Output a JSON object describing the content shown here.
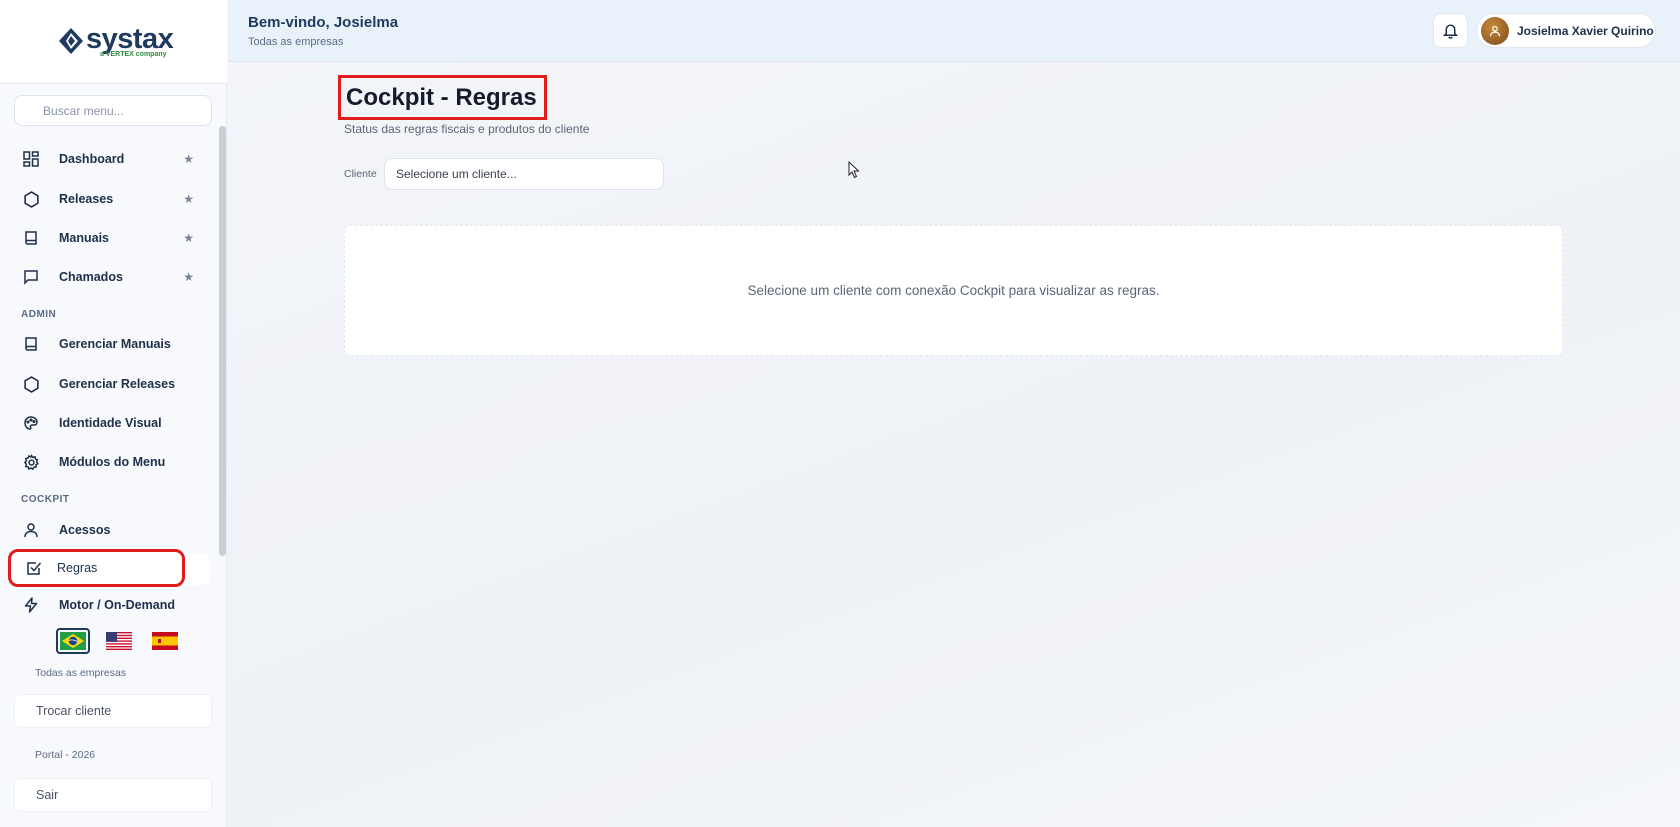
{
  "sidebar": {
    "logo_text": "systax",
    "logo_sub": "a VERTEX company",
    "search_placeholder": "Buscar menu...",
    "favorites": [
      {
        "label": "Dashboard",
        "icon": "dashboard-icon"
      },
      {
        "label": "Releases",
        "icon": "hexagon-icon"
      },
      {
        "label": "Manuais",
        "icon": "book-icon"
      },
      {
        "label": "Chamados",
        "icon": "chat-icon"
      }
    ],
    "admin_label": "ADMIN",
    "admin_items": [
      {
        "label": "Gerenciar Manuais",
        "icon": "book-icon"
      },
      {
        "label": "Gerenciar Releases",
        "icon": "hexagon-icon"
      },
      {
        "label": "Identidade Visual",
        "icon": "palette-icon"
      },
      {
        "label": "Módulos do Menu",
        "icon": "gear-icon"
      }
    ],
    "cockpit_label": "COCKPIT",
    "cockpit_items": [
      {
        "label": "Acessos",
        "icon": "user-icon"
      },
      {
        "label": "Regras",
        "icon": "checkbox-icon",
        "active": true
      },
      {
        "label": "Motor / On-Demand",
        "icon": "bolt-icon"
      }
    ],
    "languages": [
      "pt-BR",
      "en-US",
      "es-ES"
    ],
    "selected_language": "pt-BR",
    "company": "Todas as empresas",
    "switch_client_label": "Trocar cliente",
    "portal_version": "Portal - 2026",
    "logout_label": "Sair"
  },
  "header": {
    "welcome": "Bem-vindo, Josielma",
    "company": "Todas as empresas",
    "user_name": "Josielma Xavier Quirino"
  },
  "main": {
    "title": "Cockpit - Regras",
    "subtitle": "Status das regras fiscais e produtos do cliente",
    "client_label": "Cliente",
    "client_placeholder": "Selecione um cliente...",
    "empty_message": "Selecione um cliente com conexão Cockpit para visualizar as regras."
  },
  "colors": {
    "accent_navy": "#1e3a5f",
    "highlight_red": "#e01c1c",
    "logo_green": "#2e8b3a"
  }
}
